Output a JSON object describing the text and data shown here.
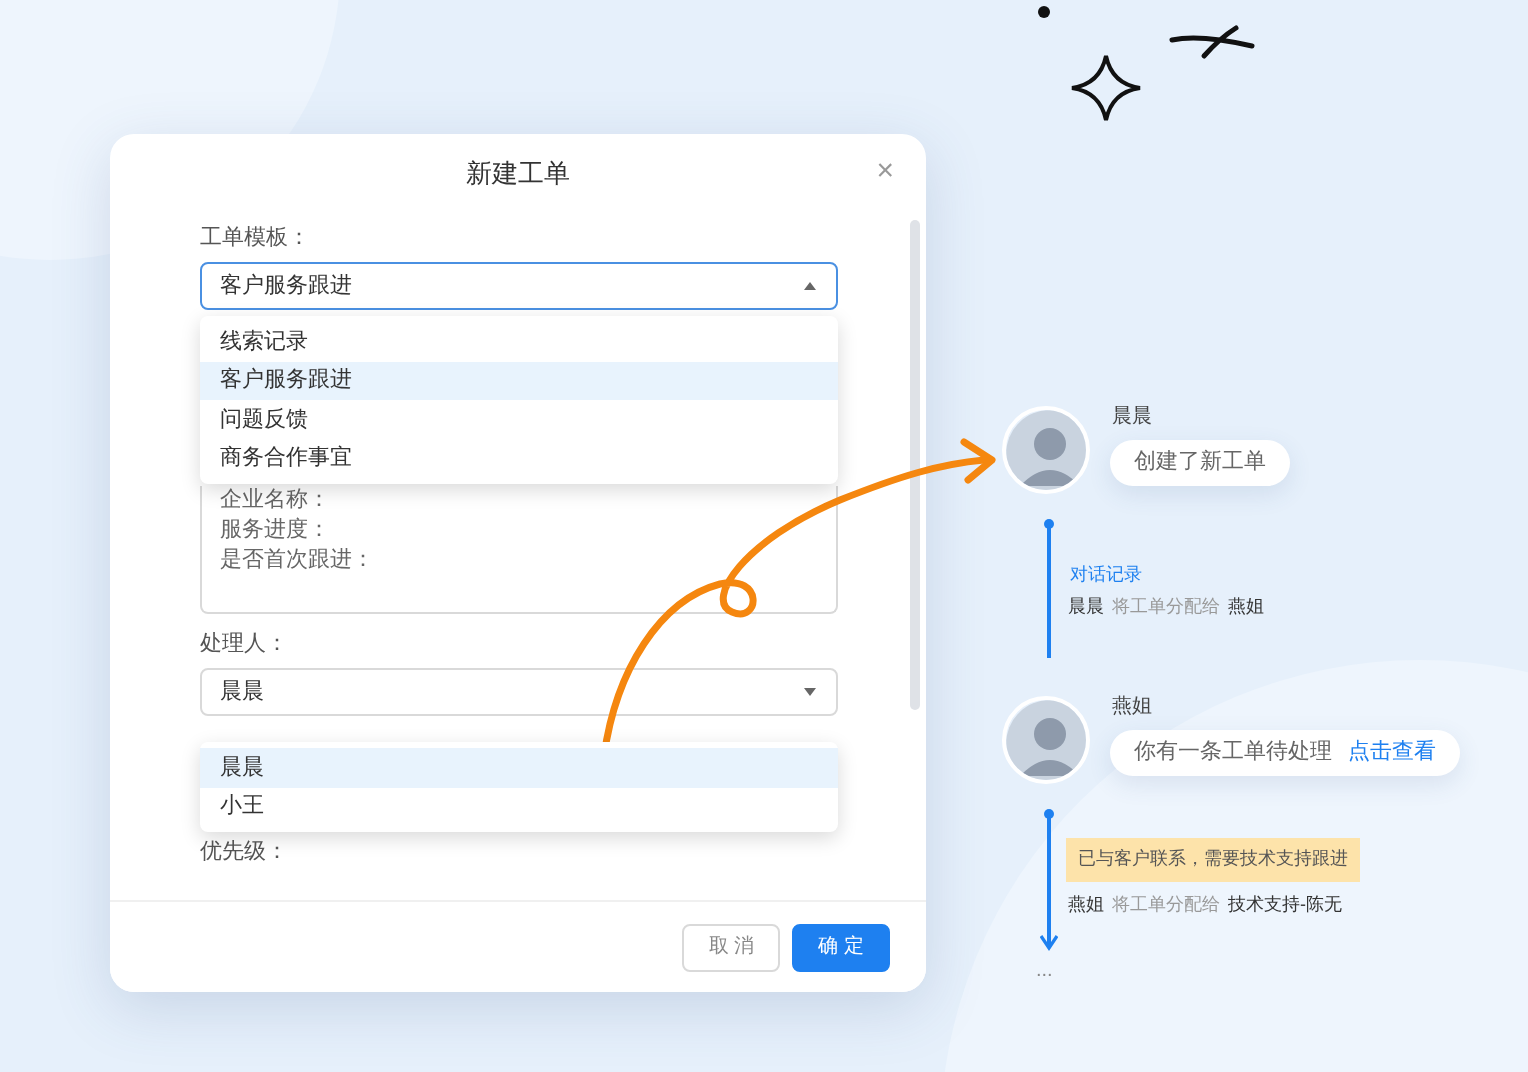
{
  "dialog": {
    "title": "新建工单",
    "close": "×",
    "template": {
      "label": "工单模板：",
      "value": "客户服务跟进",
      "expanded": true,
      "focused": true,
      "options": [
        {
          "label": "线索记录",
          "selected": false
        },
        {
          "label": "客户服务跟进",
          "selected": true
        },
        {
          "label": "问题反馈",
          "selected": false
        },
        {
          "label": "商务合作事宜",
          "selected": false
        }
      ]
    },
    "content_lines": [
      "企业名称：",
      "服务进度：",
      "是否首次跟进："
    ],
    "assignee": {
      "label": "处理人：",
      "value": "晨晨",
      "expanded": true,
      "focused": false,
      "options": [
        {
          "label": "晨晨",
          "selected": true
        },
        {
          "label": "小王",
          "selected": false
        }
      ]
    },
    "priority": {
      "label": "优先级："
    },
    "buttons": [
      {
        "label": "取 消",
        "kind": "secondary"
      },
      {
        "label": "确 定",
        "kind": "primary"
      }
    ]
  },
  "timeline": [
    {
      "name": "晨晨",
      "message": "创建了新工单",
      "note": {
        "kind": "record",
        "text": "对话记录"
      },
      "log": {
        "from": "晨晨",
        "action": "将工单分配给",
        "to": "燕姐"
      },
      "end": false
    },
    {
      "name": "燕姐",
      "message": "你有一条工单待处理",
      "link": "点击查看",
      "note": {
        "kind": "tag",
        "text": "已与客户联系，需要技术支持跟进"
      },
      "log": {
        "from": "燕姐",
        "action": "将工单分配给",
        "to": "技术支持-陈无"
      },
      "end": true
    }
  ],
  "more": "..."
}
